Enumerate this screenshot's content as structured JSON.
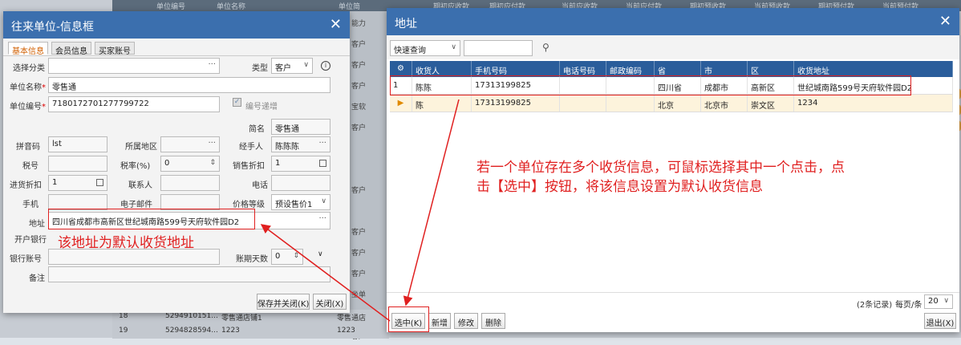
{
  "background": {
    "header_cols": [
      "单位编号",
      "单位名称",
      "单位简",
      "期初应收款",
      "期初应付款",
      "当前应收款",
      "当前应付款",
      "期初预收款",
      "当前预收款",
      "期初预付款",
      "当前预付款"
    ],
    "col_fragments": [
      "能力",
      "客户",
      "客户",
      "客户",
      "宝软",
      "客户",
      "",
      "",
      "客户",
      "",
      "客户",
      "客户",
      "客户",
      "坐单",
      "坐客户",
      "客户",
      "伍洋",
      "伍速",
      "伍速",
      "",
      "伍速",
      "花开",
      "",
      "伍速",
      "的店",
      "伍速",
      "通路",
      "钱"
    ],
    "rows": [
      {
        "num": "18",
        "code": "5294910151...",
        "name": "零售通店铺1",
        "short": "零售通店"
      },
      {
        "num": "19",
        "code": "5294828594...",
        "name": "1223",
        "short": "1223"
      }
    ]
  },
  "left_dialog": {
    "title": "往来单位-信息框",
    "tabs": [
      "基本信息",
      "会员信息",
      "买家账号"
    ],
    "fields": {
      "category_label": "选择分类",
      "type_label": "类型",
      "type_value": "客户",
      "name_label": "单位名称",
      "name_value": "零售通",
      "code_label": "单位编号",
      "code_value": "7180172701277799722",
      "auto_code_label": "编号递增",
      "short_label": "简名",
      "short_value": "零售通",
      "pinyin_label": "拼音码",
      "pinyin_value": "lst",
      "region_label": "所属地区",
      "handler_label": "经手人",
      "handler_value": "陈陈陈",
      "taxno_label": "税号",
      "taxrate_label": "税率(%)",
      "taxrate_value": "0",
      "sale_discount_label": "销售折扣",
      "sale_discount_value": "1",
      "purchase_discount_label": "进货折扣",
      "purchase_discount_value": "1",
      "contact_label": "联系人",
      "phone_label": "电话",
      "mobile_label": "手机",
      "email_label": "电子邮件",
      "price_level_label": "价格等级",
      "price_level_value": "预设售价1",
      "address_label": "地址",
      "address_value": "四川省成都市高新区世纪城南路599号天府软件园D2",
      "bank_label": "开户银行",
      "account_label": "银行账号",
      "account_days_label": "账期天数",
      "account_days_value": "0",
      "remark_label": "备注"
    },
    "save_close_button": "保存并关闭(K)",
    "close_button": "关闭(X)"
  },
  "address_dialog": {
    "title": "地址",
    "quick_search": "快速查询",
    "search_value": "",
    "columns": [
      "收货人",
      "手机号码",
      "电话号码",
      "邮政编码",
      "省",
      "市",
      "区",
      "收货地址"
    ],
    "rows": [
      {
        "marker": "1",
        "name": "陈陈",
        "mobile": "17313199825",
        "phone": "",
        "zip": "",
        "province": "四川省",
        "city": "成都市",
        "district": "高新区",
        "address": "世纪城南路599号天府软件园D2"
      },
      {
        "marker": "▶",
        "name": "陈",
        "mobile": "17313199825",
        "phone": "",
        "zip": "",
        "province": "北京",
        "city": "北京市",
        "district": "崇文区",
        "address": "1234"
      }
    ],
    "record_count": "(2条记录)",
    "per_page_label": "每页/条",
    "per_page_value": "20",
    "buttons": {
      "select": "选中(K)",
      "add": "新增",
      "edit": "修改",
      "delete": "删除",
      "exit": "退出(X)"
    }
  },
  "annotations": {
    "left_note": "该地址为默认收货地址",
    "right_note_line1": "若一个单位存在多个收货信息，可鼠标选择其中一个点击，点",
    "right_note_line2": "击【选中】按钮，将该信息设置为默认收货信息"
  },
  "colors": {
    "title_bar": "#3b6fae",
    "table_header": "#2a5d9b",
    "annotation_red": "#e02020",
    "selected_row": "#fdf3dc"
  }
}
